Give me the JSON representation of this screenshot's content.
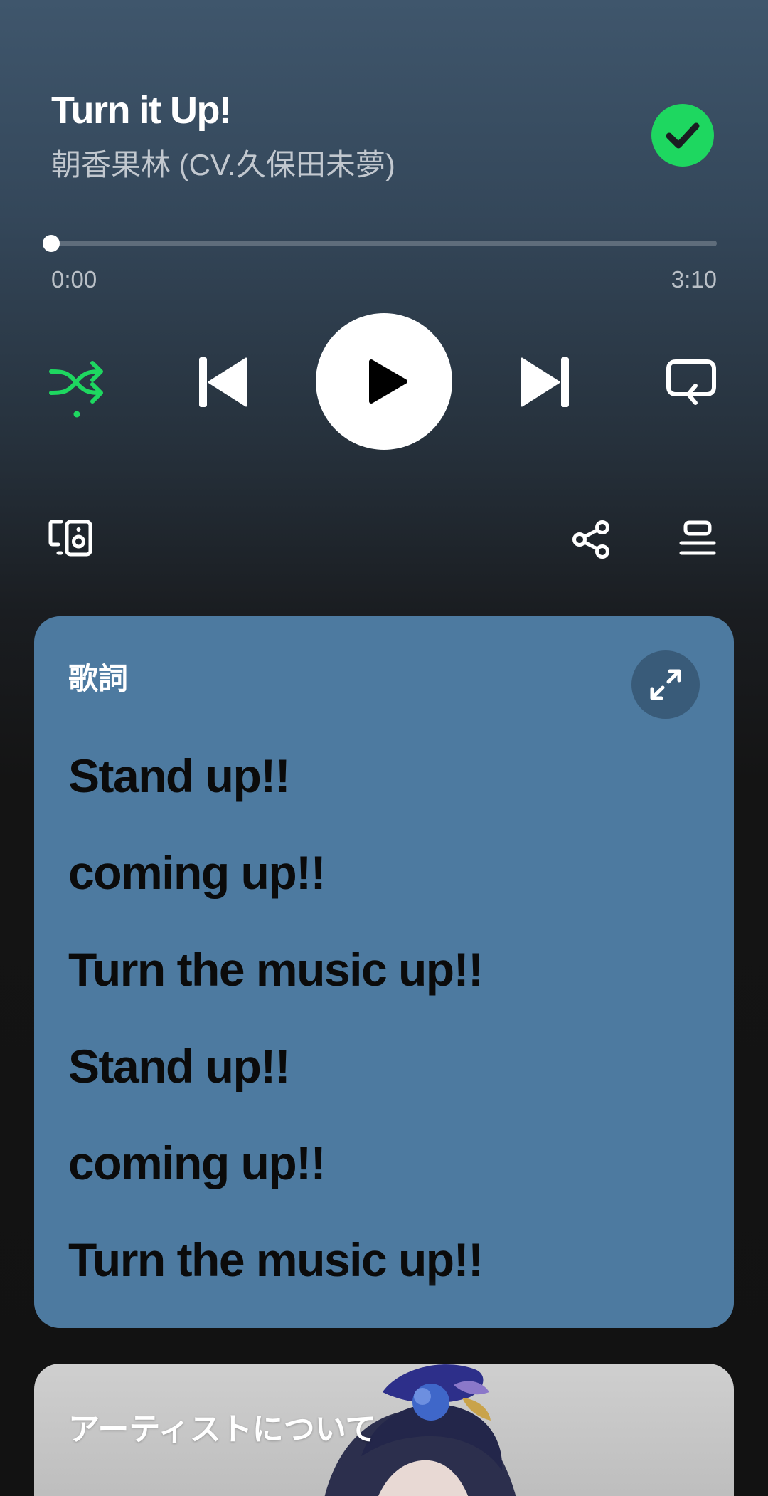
{
  "track": {
    "title": "Turn it Up!",
    "artist": "朝香果林 (CV.久保田未夢)",
    "liked": true
  },
  "playback": {
    "elapsed": "0:00",
    "duration": "3:10",
    "progress_fraction": 0,
    "shuffle_enabled": true,
    "is_playing": false
  },
  "icons": {
    "liked": "check-circle-icon",
    "shuffle": "shuffle-icon",
    "previous": "skip-previous-icon",
    "play": "play-icon",
    "next": "skip-next-icon",
    "repeat": "repeat-icon",
    "devices": "connect-device-icon",
    "share": "share-icon",
    "queue": "queue-icon",
    "expand": "expand-icon"
  },
  "lyrics": {
    "heading": "歌詞",
    "lines": [
      "Stand up!!",
      "coming up!!",
      "Turn the music up!!",
      "Stand up!!",
      "coming up!!",
      "Turn the music up!!"
    ]
  },
  "artist_section": {
    "heading": "アーティストについて"
  },
  "colors": {
    "accent_green": "#1ed760",
    "lyrics_card": "#4d7aa0",
    "background_top": "#3f566c",
    "background_bottom": "#121212"
  }
}
